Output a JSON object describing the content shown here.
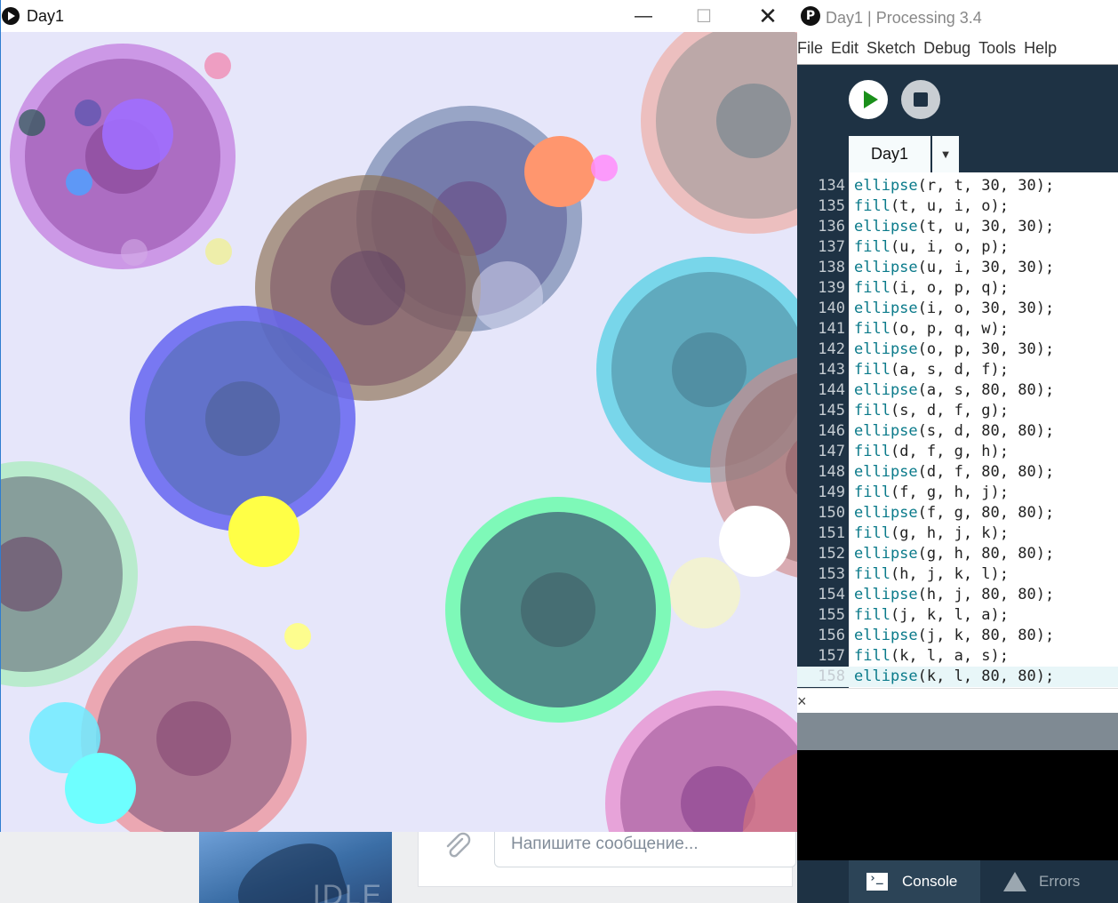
{
  "sketch_window": {
    "title": "Day1",
    "controls": {
      "minimize": "—",
      "maximize": "☐",
      "close": "✕"
    }
  },
  "ide": {
    "title": "Day1 | Processing 3.4",
    "logo": "P",
    "menu": [
      "File",
      "Edit",
      "Sketch",
      "Debug",
      "Tools",
      "Help"
    ],
    "tab_label": "Day1",
    "tab_dropdown": "▼",
    "code_lines": [
      {
        "n": "134",
        "fn": "ellipse",
        "args": "(r, t, 30, 30);"
      },
      {
        "n": "135",
        "fn": "fill",
        "args": "(t, u, i, o);"
      },
      {
        "n": "136",
        "fn": "ellipse",
        "args": "(t, u, 30, 30);"
      },
      {
        "n": "137",
        "fn": "fill",
        "args": "(u, i, o, p);"
      },
      {
        "n": "138",
        "fn": "ellipse",
        "args": "(u, i, 30, 30);"
      },
      {
        "n": "139",
        "fn": "fill",
        "args": "(i, o, p, q);"
      },
      {
        "n": "140",
        "fn": "ellipse",
        "args": "(i, o, 30, 30);"
      },
      {
        "n": "141",
        "fn": "fill",
        "args": "(o, p, q, w);"
      },
      {
        "n": "142",
        "fn": "ellipse",
        "args": "(o, p, 30, 30);"
      },
      {
        "n": "143",
        "fn": "fill",
        "args": "(a, s, d, f);"
      },
      {
        "n": "144",
        "fn": "ellipse",
        "args": "(a, s, 80, 80);"
      },
      {
        "n": "145",
        "fn": "fill",
        "args": "(s, d, f, g);"
      },
      {
        "n": "146",
        "fn": "ellipse",
        "args": "(s, d, 80, 80);"
      },
      {
        "n": "147",
        "fn": "fill",
        "args": "(d, f, g, h);"
      },
      {
        "n": "148",
        "fn": "ellipse",
        "args": "(d, f, 80, 80);"
      },
      {
        "n": "149",
        "fn": "fill",
        "args": "(f, g, h, j);"
      },
      {
        "n": "150",
        "fn": "ellipse",
        "args": "(f, g, 80, 80);"
      },
      {
        "n": "151",
        "fn": "fill",
        "args": "(g, h, j, k);"
      },
      {
        "n": "152",
        "fn": "ellipse",
        "args": "(g, h, 80, 80);"
      },
      {
        "n": "153",
        "fn": "fill",
        "args": "(h, j, k, l);"
      },
      {
        "n": "154",
        "fn": "ellipse",
        "args": "(h, j, 80, 80);"
      },
      {
        "n": "155",
        "fn": "fill",
        "args": "(j, k, l, a);"
      },
      {
        "n": "156",
        "fn": "ellipse",
        "args": "(j, k, 80, 80);"
      },
      {
        "n": "157",
        "fn": "fill",
        "args": "(k, l, a, s);"
      },
      {
        "n": "158",
        "fn": "ellipse",
        "args": "(k, l, 80, 80);"
      }
    ],
    "collapse_label": "×",
    "footer": {
      "console": "Console",
      "errors": "Errors"
    }
  },
  "background_app": {
    "message_placeholder": "Напишите сообщение..."
  },
  "colors": {
    "canvas_bg": "#e6e6fa",
    "ide_dark": "#1e3244",
    "keyword": "#0a7a8a",
    "run_green": "#1a8f1a"
  }
}
